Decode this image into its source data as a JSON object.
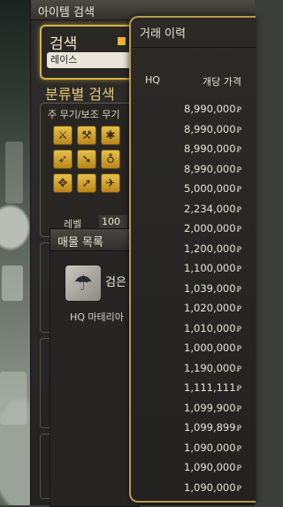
{
  "search_window": {
    "title": "아이템 검색",
    "search_label": "검색",
    "search_value": "레이스",
    "category_title": "분류별 검색",
    "category_subtitle": "주 무기/보조 무기",
    "level_label": "레벨",
    "level_value": "100"
  },
  "listings_window": {
    "title": "매물 목록",
    "item_name": "검은",
    "header": "HQ 마테리아"
  },
  "history_window": {
    "title": "거래 이력",
    "col_hq": "HQ",
    "col_price": "개당 가격",
    "currency": "Ꝑ",
    "prices": [
      "8,990,000",
      "8,990,000",
      "8,990,000",
      "8,990,000",
      "5,000,000",
      "2,234,000",
      "2,000,000",
      "1,200,000",
      "1,100,000",
      "1,039,000",
      "1,020,000",
      "1,010,000",
      "1,000,000",
      "1,190,000",
      "1,111,111",
      "1,099,900",
      "1,099,899",
      "1,090,000",
      "1,090,000",
      "1,090,000"
    ]
  },
  "category_icons": [
    {
      "name": "gladiator-icon",
      "glyph": "⚔"
    },
    {
      "name": "pugilist-icon",
      "glyph": "⚒"
    },
    {
      "name": "marauder-icon",
      "glyph": "✱"
    },
    {
      "name": "archer-icon",
      "glyph": "➶"
    },
    {
      "name": "lancer-icon",
      "glyph": "➘"
    },
    {
      "name": "conjurer-icon",
      "glyph": "♁"
    },
    {
      "name": "thaumaturge-icon",
      "glyph": "✥"
    },
    {
      "name": "rogue-icon",
      "glyph": "➚"
    },
    {
      "name": "machinist-icon",
      "glyph": "✈"
    }
  ]
}
